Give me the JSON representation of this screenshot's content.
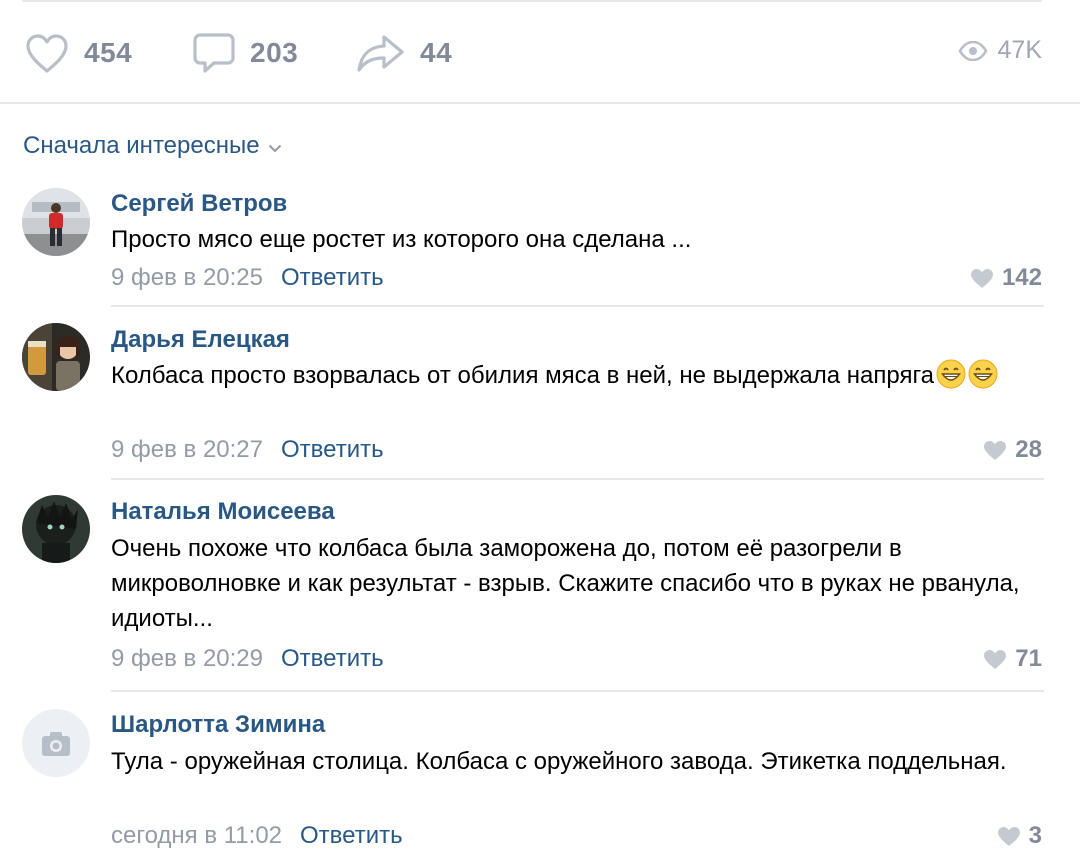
{
  "actions": {
    "likes": "454",
    "comments": "203",
    "shares": "44",
    "views": "47K"
  },
  "sort": {
    "label": "Сначала интересные"
  },
  "comments": [
    {
      "author": "Сергей Ветров",
      "text": "Просто мясо еще ростет из которого она сделана ...",
      "date": "9 фев в 20:25",
      "reply": "Ответить",
      "likes": "142"
    },
    {
      "author": "Дарья Елецкая",
      "text": "Колбаса просто взорвалась от обилия мяса в ней, не выдержала напряга",
      "emoji": [
        "grinning-face-icon",
        "grinning-face-icon"
      ],
      "date": "9 фев в 20:27",
      "reply": "Ответить",
      "likes": "28"
    },
    {
      "author": "Наталья Моисеева",
      "text": "Очень похоже что колбаса была заморожена до, потом её разогрели в микроволновке и как результат - взрыв. Скажите спасибо что в руках не рванула, идиоты...",
      "date": "9 фев в 20:29",
      "reply": "Ответить",
      "likes": "71"
    },
    {
      "author": "Шарлотта Зимина",
      "text": "Тула - оружейная столица. Колбаса с оружейного завода. Этикетка поддельная.",
      "date": "сегодня в 11:02",
      "reply": "Ответить",
      "likes": "3"
    }
  ],
  "colors": {
    "link": "#2a5885",
    "muted": "#939ba6",
    "icon": "#b8bfc9",
    "divider": "#e7e8ec"
  }
}
